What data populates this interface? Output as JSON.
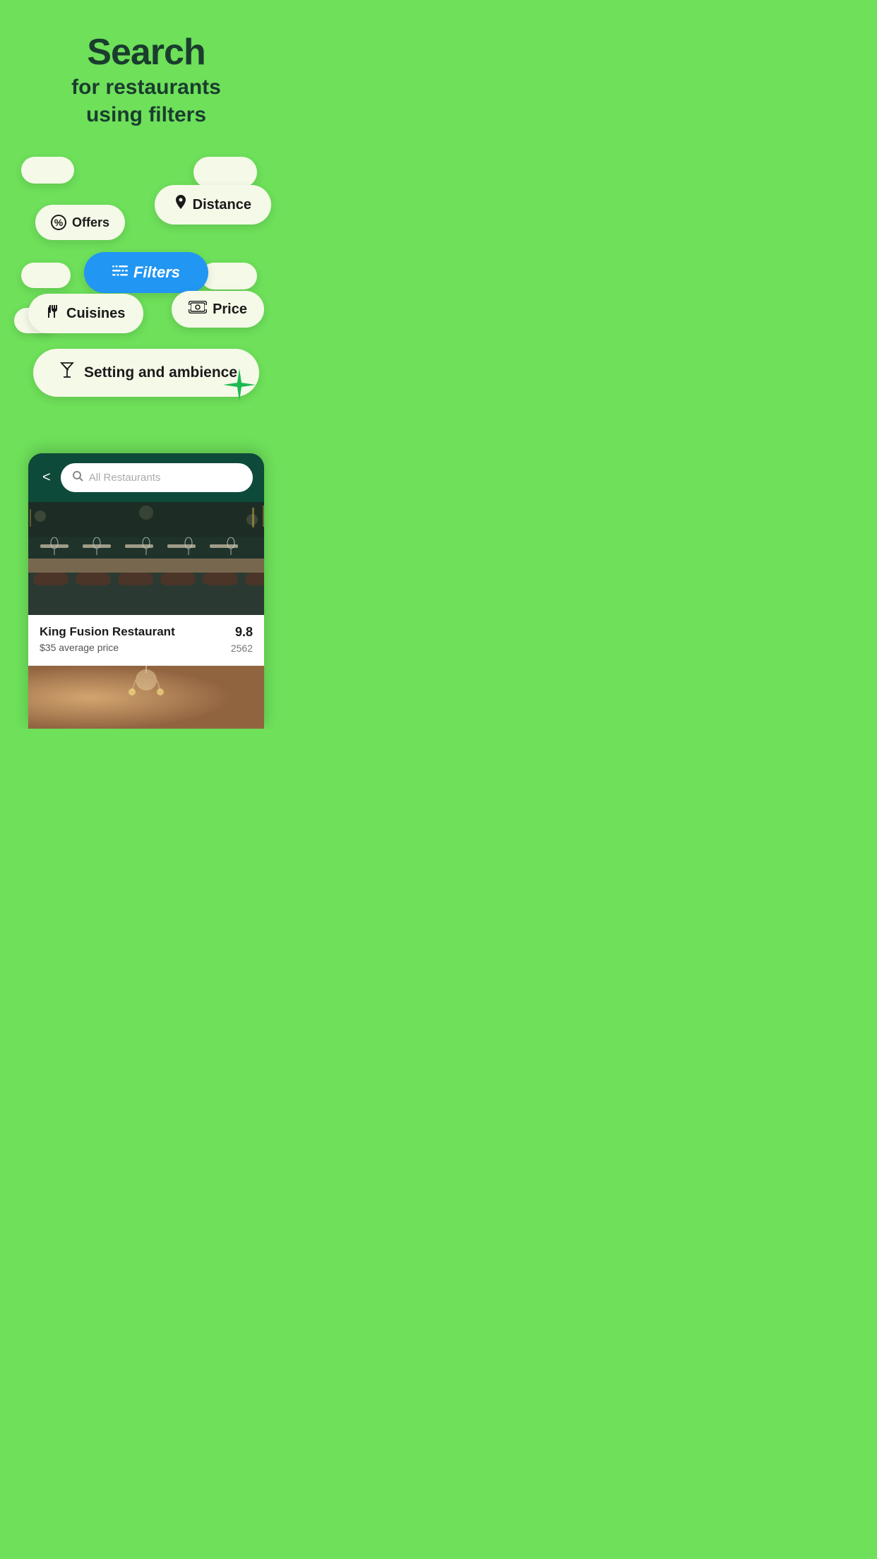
{
  "header": {
    "title": "Search",
    "subtitle_line1": "for restaurants",
    "subtitle_line2": "using filters"
  },
  "pills": {
    "offers_label": "Offers",
    "distance_label": "Distance",
    "filters_label": "Filters",
    "cuisines_label": "Cuisines",
    "price_label": "Price",
    "setting_label": "Setting and ambience"
  },
  "search_bar": {
    "placeholder": "All Restaurants",
    "back_label": "<"
  },
  "restaurant": {
    "name": "King Fusion Restaurant",
    "price_text": "$35 average price",
    "rating": "9.8",
    "reviews": "2562"
  },
  "colors": {
    "background": "#6EE05A",
    "dark_green": "#1a3d2e",
    "pill_bg": "#f5f9e8",
    "filters_blue": "#2196F3",
    "app_dark": "#0d4a3a"
  }
}
